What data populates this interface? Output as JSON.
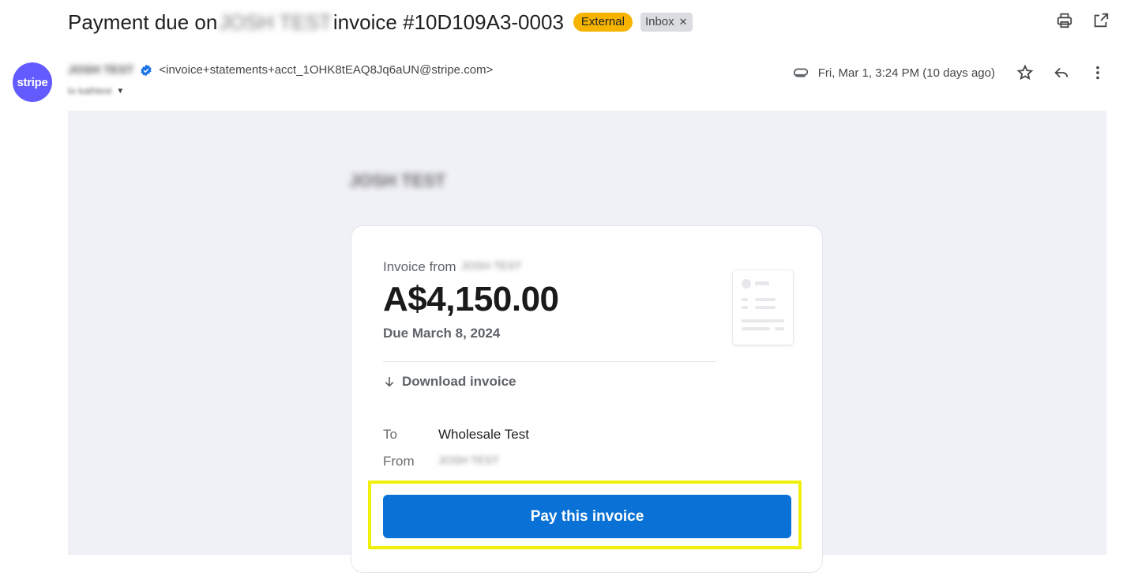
{
  "email": {
    "subject_prefix": "Payment due on",
    "subject_blurred": "JOSH TEST",
    "subject_suffix": "invoice #10D109A3-0003",
    "labels": {
      "external": "External",
      "inbox": "Inbox"
    },
    "sender": {
      "avatar_text": "stripe",
      "name_blurred": "JOSH TEST",
      "email": "<invoice+statements+acct_1OHK8tEAQ8Jq6aUN@stripe.com>",
      "to_blurred": "to kathtest"
    },
    "date": "Fri, Mar 1, 3:24 PM (10 days ago)"
  },
  "invoice": {
    "merchant_blurred": "JOSH TEST",
    "from_label": "Invoice from",
    "from_blurred": "JOSH TEST",
    "amount": "A$4,150.00",
    "due": "Due March 8, 2024",
    "download_label": "Download invoice",
    "to_label": "To",
    "to_value": "Wholesale Test",
    "from_field_label": "From",
    "from_value_blurred": "JOSH TEST",
    "pay_button": "Pay this invoice"
  },
  "icons": {
    "print": "print-icon",
    "open_new": "open-in-new-window-icon",
    "verified": "verified-badge-icon",
    "attachment": "attachment-icon",
    "star": "star-icon",
    "reply": "reply-icon",
    "more": "more-vertical-icon",
    "download": "arrow-down-icon"
  },
  "colors": {
    "stripe_purple": "#635bff",
    "external_badge": "#f6b400",
    "pay_button": "#0a72d6",
    "highlight": "#f0f00a"
  }
}
